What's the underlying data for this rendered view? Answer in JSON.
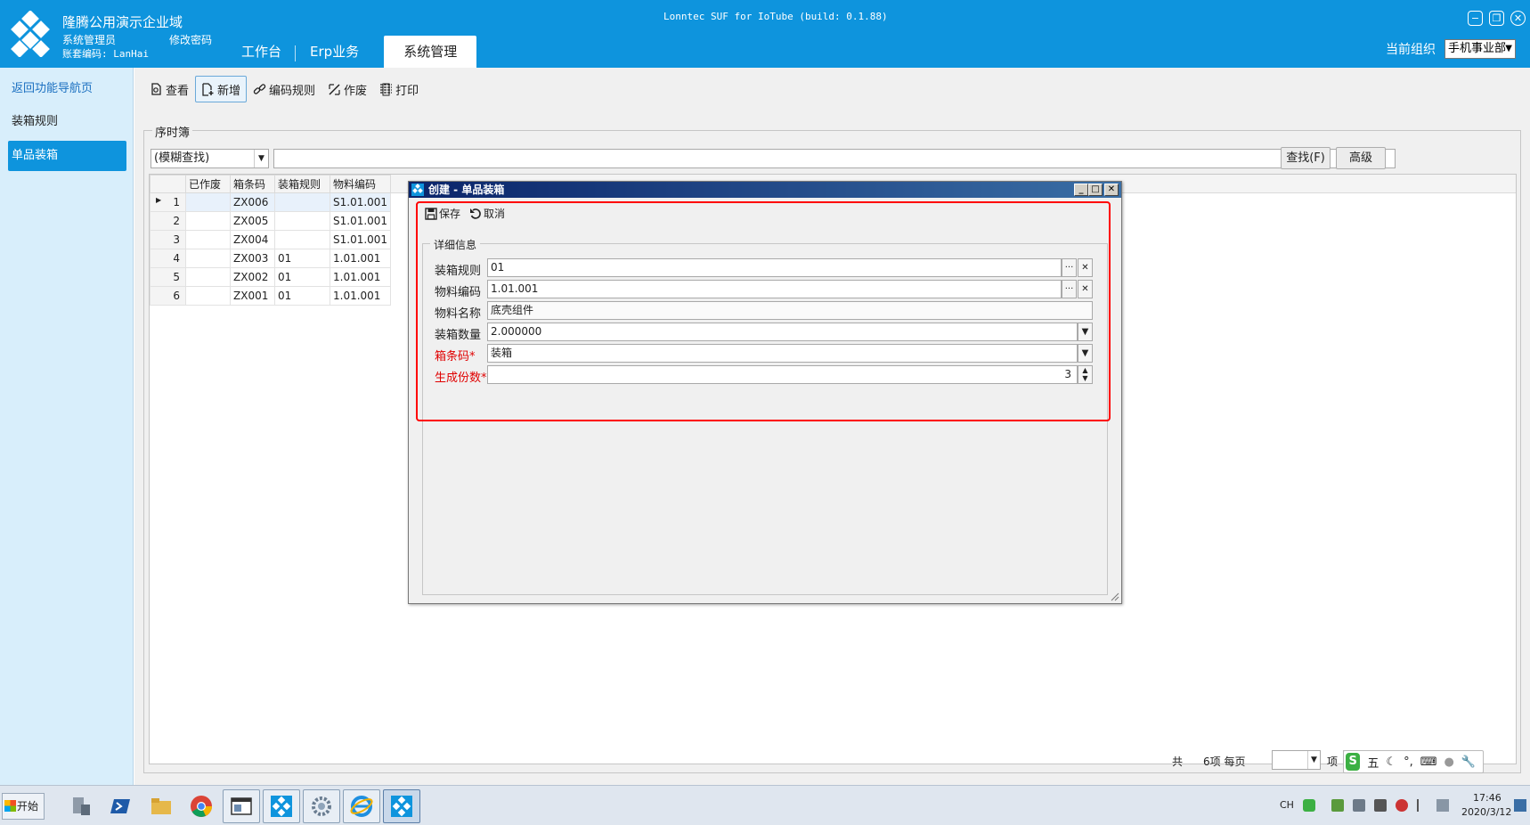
{
  "header": {
    "org_title": "隆腾公用演示企业域",
    "user_role": "系统管理员",
    "change_password": "修改密码",
    "account_code": "账套编码: LanHai",
    "app_version": "Lonntec SUF for IoTube (build: 0.1.88)",
    "tabs": [
      {
        "label": "工作台"
      },
      {
        "label": "Erp业务"
      },
      {
        "label": "系统管理",
        "active": true
      }
    ],
    "org_label": "当前组织",
    "org_value": "手机事业部",
    "colors": {
      "brand": "#0e94dd"
    }
  },
  "sidebar": {
    "items": [
      {
        "label": "返回功能导航页",
        "kind": "link"
      },
      {
        "label": "装箱规则"
      },
      {
        "label": "单品装箱",
        "active": true
      }
    ]
  },
  "toolbar": {
    "items": [
      {
        "label": "查看",
        "icon": "view-icon"
      },
      {
        "label": "新增",
        "icon": "add-doc-icon",
        "pressed": true
      },
      {
        "label": "编码规则",
        "icon": "link-icon"
      },
      {
        "label": "作废",
        "icon": "void-icon"
      },
      {
        "label": "打印",
        "icon": "print-icon"
      }
    ]
  },
  "search": {
    "group_title": "序时簿",
    "type_value": "(模糊查找)",
    "query_value": "",
    "find_button": "查找(F)",
    "advanced_button": "高级"
  },
  "grid": {
    "columns": [
      "已作废",
      "箱条码",
      "装箱规则",
      "物料编码"
    ],
    "rows": [
      {
        "no": "1",
        "voided": "",
        "box_code": "ZX006",
        "rule": "",
        "material": "S1.01.001",
        "current": true
      },
      {
        "no": "2",
        "voided": "",
        "box_code": "ZX005",
        "rule": "",
        "material": "S1.01.001"
      },
      {
        "no": "3",
        "voided": "",
        "box_code": "ZX004",
        "rule": "",
        "material": "S1.01.001"
      },
      {
        "no": "4",
        "voided": "",
        "box_code": "ZX003",
        "rule": "01",
        "material": "1.01.001"
      },
      {
        "no": "5",
        "voided": "",
        "box_code": "ZX002",
        "rule": "01",
        "material": "1.01.001"
      },
      {
        "no": "6",
        "voided": "",
        "box_code": "ZX001",
        "rule": "01",
        "material": "1.01.001"
      }
    ]
  },
  "pager": {
    "total_label": "共",
    "count_text": "6项 每页",
    "page_size": "",
    "unit_label": "项"
  },
  "dialog": {
    "title": "创建 - 单品装箱",
    "save_label": "保存",
    "cancel_label": "取消",
    "section_title": "详细信息",
    "fields": {
      "packing_rule": {
        "label": "装箱规则",
        "value": "01"
      },
      "material_code": {
        "label": "物料编码",
        "value": "1.01.001"
      },
      "material_name": {
        "label": "物料名称",
        "value": "底壳组件"
      },
      "packing_qty": {
        "label": "装箱数量",
        "value": "2.000000"
      },
      "box_barcode": {
        "label": "箱条码*",
        "value": "装箱",
        "required": true
      },
      "copies": {
        "label": "生成份数*",
        "value": "3",
        "required": true
      }
    }
  },
  "taskbar": {
    "start_label": "开始",
    "lang": "CH",
    "time": "17:46",
    "date": "2020/3/12",
    "apps": [
      "server-manager-icon",
      "powershell-icon",
      "file-explorer-icon",
      "chrome-icon",
      "window-app-icon",
      "lonntec-icon",
      "settings-gear-icon",
      "ie-icon",
      "lonntec-icon"
    ]
  },
  "ime": {
    "mode_char": "五",
    "icons": [
      "sogou-icon",
      "moon-icon",
      "punct-icon",
      "keyboard-icon",
      "user-icon",
      "wrench-icon"
    ]
  }
}
